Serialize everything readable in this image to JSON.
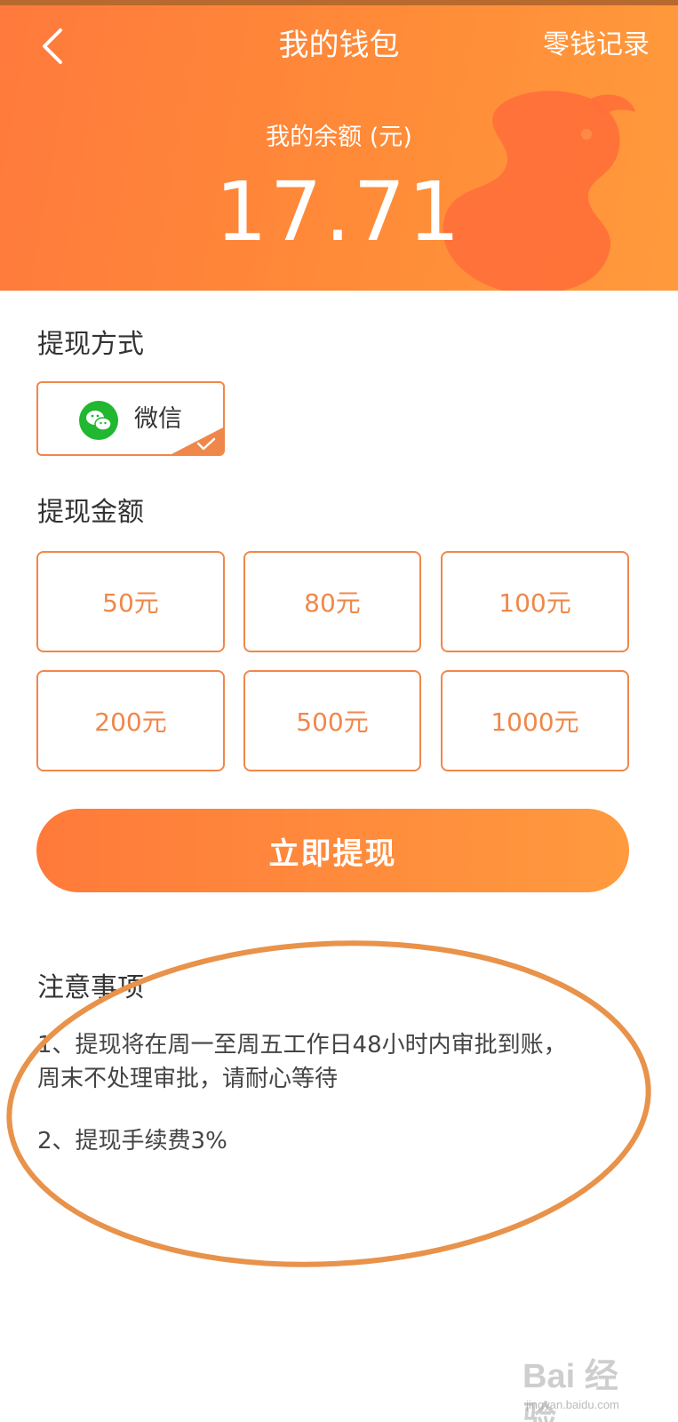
{
  "header": {
    "title": "我的钱包",
    "records_link": "零钱记录",
    "balance_label": "我的余额 (元)",
    "balance_value": "17.71"
  },
  "withdraw_method": {
    "section_title": "提现方式",
    "selected_method": "微信",
    "icons": [
      "back-arrow-icon",
      "wechat-icon",
      "checkmark-icon"
    ]
  },
  "withdraw_amount": {
    "section_title": "提现金额",
    "options": [
      "50元",
      "80元",
      "100元",
      "200元",
      "500元",
      "1000元"
    ]
  },
  "submit_button": "立即提现",
  "notes": {
    "title": "注意事项",
    "items": [
      "1、提现将在周一至周五工作日48小时内审批到账，",
      "周末不处理审批，请耐心等待",
      "2、提现手续费3%"
    ]
  },
  "watermark": {
    "brand": "Bai 经验",
    "url": "jingyan.baidu.com"
  },
  "colors": {
    "accent": "#ff8a3c",
    "outline": "#f0874a",
    "wechat_green": "#21b731",
    "annotation": "#e8924a"
  }
}
